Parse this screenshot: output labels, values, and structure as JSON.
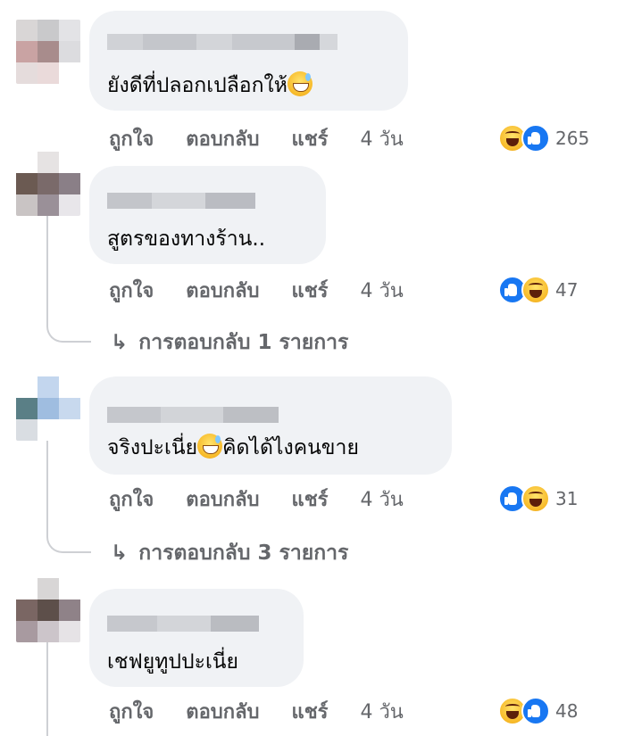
{
  "actions": {
    "like": "ถูกใจ",
    "reply": "ตอบกลับ",
    "share": "แชร์"
  },
  "comments": [
    {
      "text_before": "ยังดีที่ปลอกเปลือกให้",
      "text_after": "",
      "emoji": "grinning-sweat-emoji",
      "time": "4 วัน",
      "reaction_count": "265",
      "reactions": [
        "haha",
        "like"
      ]
    },
    {
      "text_before": "สูตรของทางร้าน..",
      "text_after": "",
      "emoji": "",
      "time": "4 วัน",
      "reaction_count": "47",
      "reactions": [
        "like",
        "haha"
      ],
      "replies": "การตอบกลับ 1 รายการ"
    },
    {
      "text_before": "จริงปะเนี่ย",
      "text_after": "คิดได้ไงคนขาย",
      "emoji": "grinning-sweat-emoji",
      "time": "4 วัน",
      "reaction_count": "31",
      "reactions": [
        "like",
        "haha"
      ],
      "replies": "การตอบกลับ 3 รายการ"
    },
    {
      "text_before": "เชฟยูทูปปะเนี่ย",
      "text_after": "",
      "emoji": "",
      "time": "4 วัน",
      "reaction_count": "48",
      "reactions": [
        "haha",
        "like"
      ]
    }
  ],
  "icons": {
    "reply_arrow": "reply-arrow-icon",
    "like": "like-icon",
    "haha": "haha-icon"
  },
  "colors": {
    "bubble": "#f0f2f5",
    "meta_text": "#65676b",
    "like_blue": "#1877f2",
    "haha_yellow": "#f7b928"
  }
}
